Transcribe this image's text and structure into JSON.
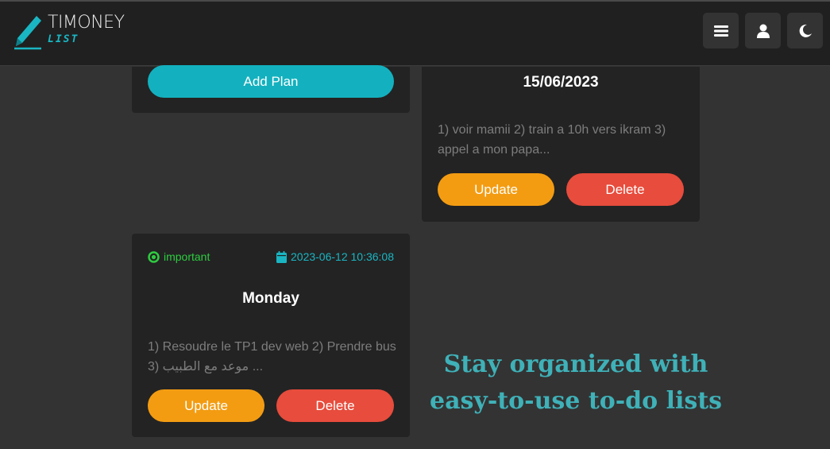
{
  "header": {
    "logo_title": "TIMONEY",
    "logo_subtitle": "LIST",
    "menu_icon": "hamburger-icon",
    "user_icon": "user-icon",
    "theme_icon": "moon-icon"
  },
  "add_card": {
    "button_label": "Add Plan"
  },
  "plans": [
    {
      "title": "15/06/2023",
      "description": "1) voir mamii 2) train a 10h vers ikram 3) appel a mon papa...",
      "update_label": "Update",
      "delete_label": "Delete"
    },
    {
      "priority": "important",
      "datetime": "2023-06-12 10:36:08",
      "title": "Monday",
      "description": "1) Resoudre le TP1 dev web 2) Prendre bus 3) موعد مع الطبيب ...",
      "update_label": "Update",
      "delete_label": "Delete"
    }
  ],
  "tagline": "Stay organized with easy-to-use to-do lists",
  "colors": {
    "accent": "#13b1bf",
    "update": "#f39c12",
    "delete": "#e74c3c",
    "priority": "#2ecc40",
    "tagline": "#3fb1b8"
  }
}
